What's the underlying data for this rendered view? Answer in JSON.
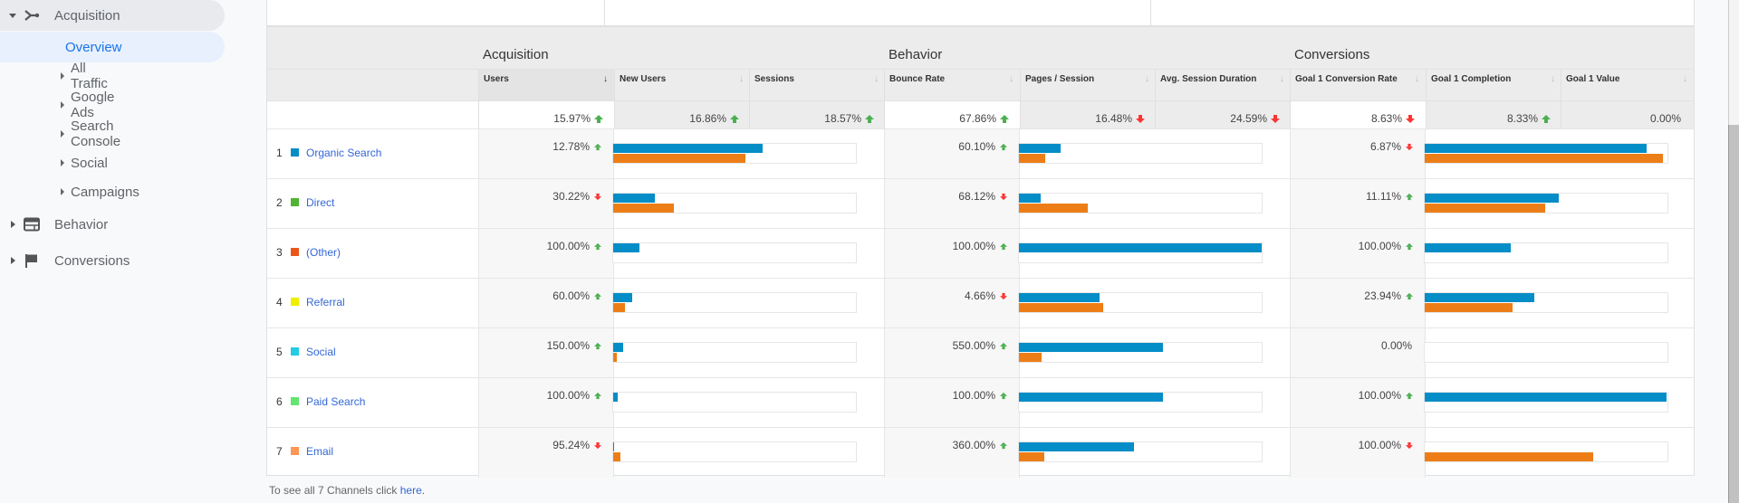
{
  "sidebar": {
    "acquisition": "Acquisition",
    "overview": "Overview",
    "sub_items": [
      "All Traffic",
      "Google Ads",
      "Search Console",
      "Social",
      "Campaigns"
    ],
    "behavior": "Behavior",
    "conversions": "Conversions"
  },
  "table": {
    "groups": [
      "Acquisition",
      "Behavior",
      "Conversions"
    ],
    "columns": [
      "Users",
      "New Users",
      "Sessions",
      "Bounce Rate",
      "Pages / Session",
      "Avg. Session Duration",
      "Goal 1 Conversion Rate",
      "Goal 1 Completion",
      "Goal 1 Value"
    ],
    "sorted_column": "Users",
    "summary": [
      {
        "value": "15.97%",
        "trend": "up"
      },
      {
        "value": "16.86%",
        "trend": "up"
      },
      {
        "value": "18.57%",
        "trend": "up"
      },
      {
        "value": "67.86%",
        "trend": "up"
      },
      {
        "value": "16.48%",
        "trend": "down"
      },
      {
        "value": "24.59%",
        "trend": "down"
      },
      {
        "value": "8.63%",
        "trend": "down"
      },
      {
        "value": "8.33%",
        "trend": "up"
      },
      {
        "value": "0.00%",
        "trend": "none"
      }
    ],
    "rows": [
      {
        "index": "1",
        "channel": "Organic Search",
        "color": "#058dc7",
        "acq": {
          "value": "12.78%",
          "trend": "up",
          "bars": [
            61.6,
            54.6
          ]
        },
        "beh": {
          "value": "60.10%",
          "trend": "up",
          "bars": [
            17.0,
            10.7
          ]
        },
        "conv": {
          "value": "6.87%",
          "trend": "down",
          "bars": [
            91.5,
            98.0
          ]
        }
      },
      {
        "index": "2",
        "channel": "Direct",
        "color": "#50b432",
        "acq": {
          "value": "30.22%",
          "trend": "down",
          "bars": [
            17.3,
            25.1
          ]
        },
        "beh": {
          "value": "68.12%",
          "trend": "down",
          "bars": [
            8.9,
            28.5
          ]
        },
        "conv": {
          "value": "11.11%",
          "trend": "up",
          "bars": [
            55.4,
            49.8
          ]
        }
      },
      {
        "index": "3",
        "channel": "(Other)",
        "color": "#ed561b",
        "acq": {
          "value": "100.00%",
          "trend": "up",
          "bars": [
            11.0,
            0
          ]
        },
        "beh": {
          "value": "100.00%",
          "trend": "up",
          "bars": [
            100.0,
            0
          ]
        },
        "conv": {
          "value": "100.00%",
          "trend": "up",
          "bars": [
            35.4,
            0
          ]
        }
      },
      {
        "index": "4",
        "channel": "Referral",
        "color": "#edef00",
        "acq": {
          "value": "60.00%",
          "trend": "up",
          "bars": [
            7.7,
            4.8
          ]
        },
        "beh": {
          "value": "4.66%",
          "trend": "down",
          "bars": [
            33.3,
            34.8
          ]
        },
        "conv": {
          "value": "23.94%",
          "trend": "up",
          "bars": [
            45.0,
            36.2
          ]
        }
      },
      {
        "index": "5",
        "channel": "Social",
        "color": "#24cbe5",
        "acq": {
          "value": "150.00%",
          "trend": "up",
          "bars": [
            4.0,
            1.5
          ]
        },
        "beh": {
          "value": "550.00%",
          "trend": "up",
          "bars": [
            59.3,
            9.3
          ]
        },
        "conv": {
          "value": "0.00%",
          "trend": "none",
          "bars": [
            0,
            0
          ]
        }
      },
      {
        "index": "6",
        "channel": "Paid Search",
        "color": "#64e572",
        "acq": {
          "value": "100.00%",
          "trend": "up",
          "bars": [
            1.8,
            0
          ]
        },
        "beh": {
          "value": "100.00%",
          "trend": "up",
          "bars": [
            59.3,
            0
          ]
        },
        "conv": {
          "value": "100.00%",
          "trend": "up",
          "bars": [
            99.6,
            0
          ]
        }
      },
      {
        "index": "7",
        "channel": "Email",
        "color": "#ff9655",
        "acq": {
          "value": "95.24%",
          "trend": "down",
          "bars": [
            0.4,
            3.0
          ]
        },
        "beh": {
          "value": "360.00%",
          "trend": "up",
          "bars": [
            47.4,
            10.4
          ]
        },
        "conv": {
          "value": "100.00%",
          "trend": "down",
          "bars": [
            0,
            69.4
          ]
        }
      }
    ],
    "bar_colors": {
      "current": "#058dc7",
      "previous": "#ed7e17"
    }
  },
  "footer": {
    "text": "To see all 7 Channels click ",
    "link": "here",
    "end": "."
  }
}
